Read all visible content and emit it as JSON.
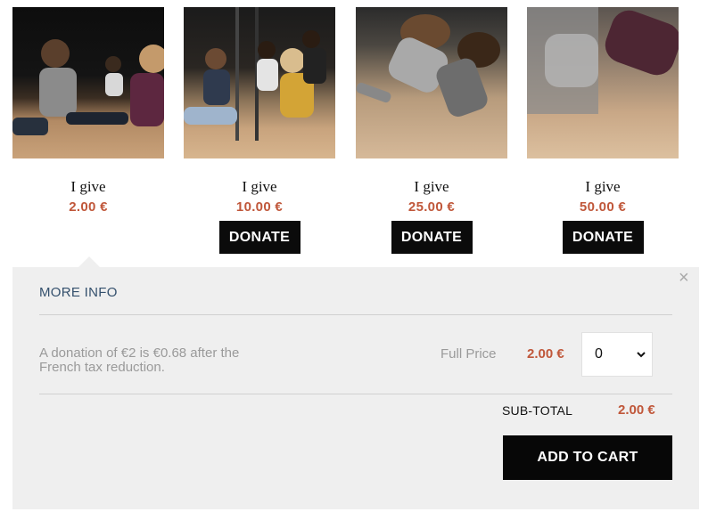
{
  "options": [
    {
      "photo": "students-seated-on-stage-photo",
      "give_label": "I give",
      "amount": "2.00 €",
      "button": ""
    },
    {
      "photo": "students-on-stage-photo",
      "give_label": "I give",
      "amount": "10.00 €",
      "button": "DONATE"
    },
    {
      "photo": "girls-dancing-photo",
      "give_label": "I give",
      "amount": "25.00 €",
      "button": "DONATE"
    },
    {
      "photo": "dancer-on-floor-photo",
      "give_label": "I give",
      "amount": "50.00 €",
      "button": "DONATE"
    }
  ],
  "panel": {
    "title": "MORE INFO",
    "close_icon": "×",
    "tax_note": "A donation of €2 is €0.68 after the French tax reduction.",
    "price_label": "Full Price",
    "price_value": "2.00 €",
    "quantity": {
      "selected": "0",
      "icon": "chevron-down"
    },
    "subtotal_label": "SUB-TOTAL",
    "subtotal_value": "2.00 €",
    "add_to_cart": "ADD TO CART"
  },
  "colors": {
    "accent_price": "#c0573a",
    "button_bg": "#0b0b0b",
    "panel_bg": "#efefef",
    "link": "#34506d"
  }
}
